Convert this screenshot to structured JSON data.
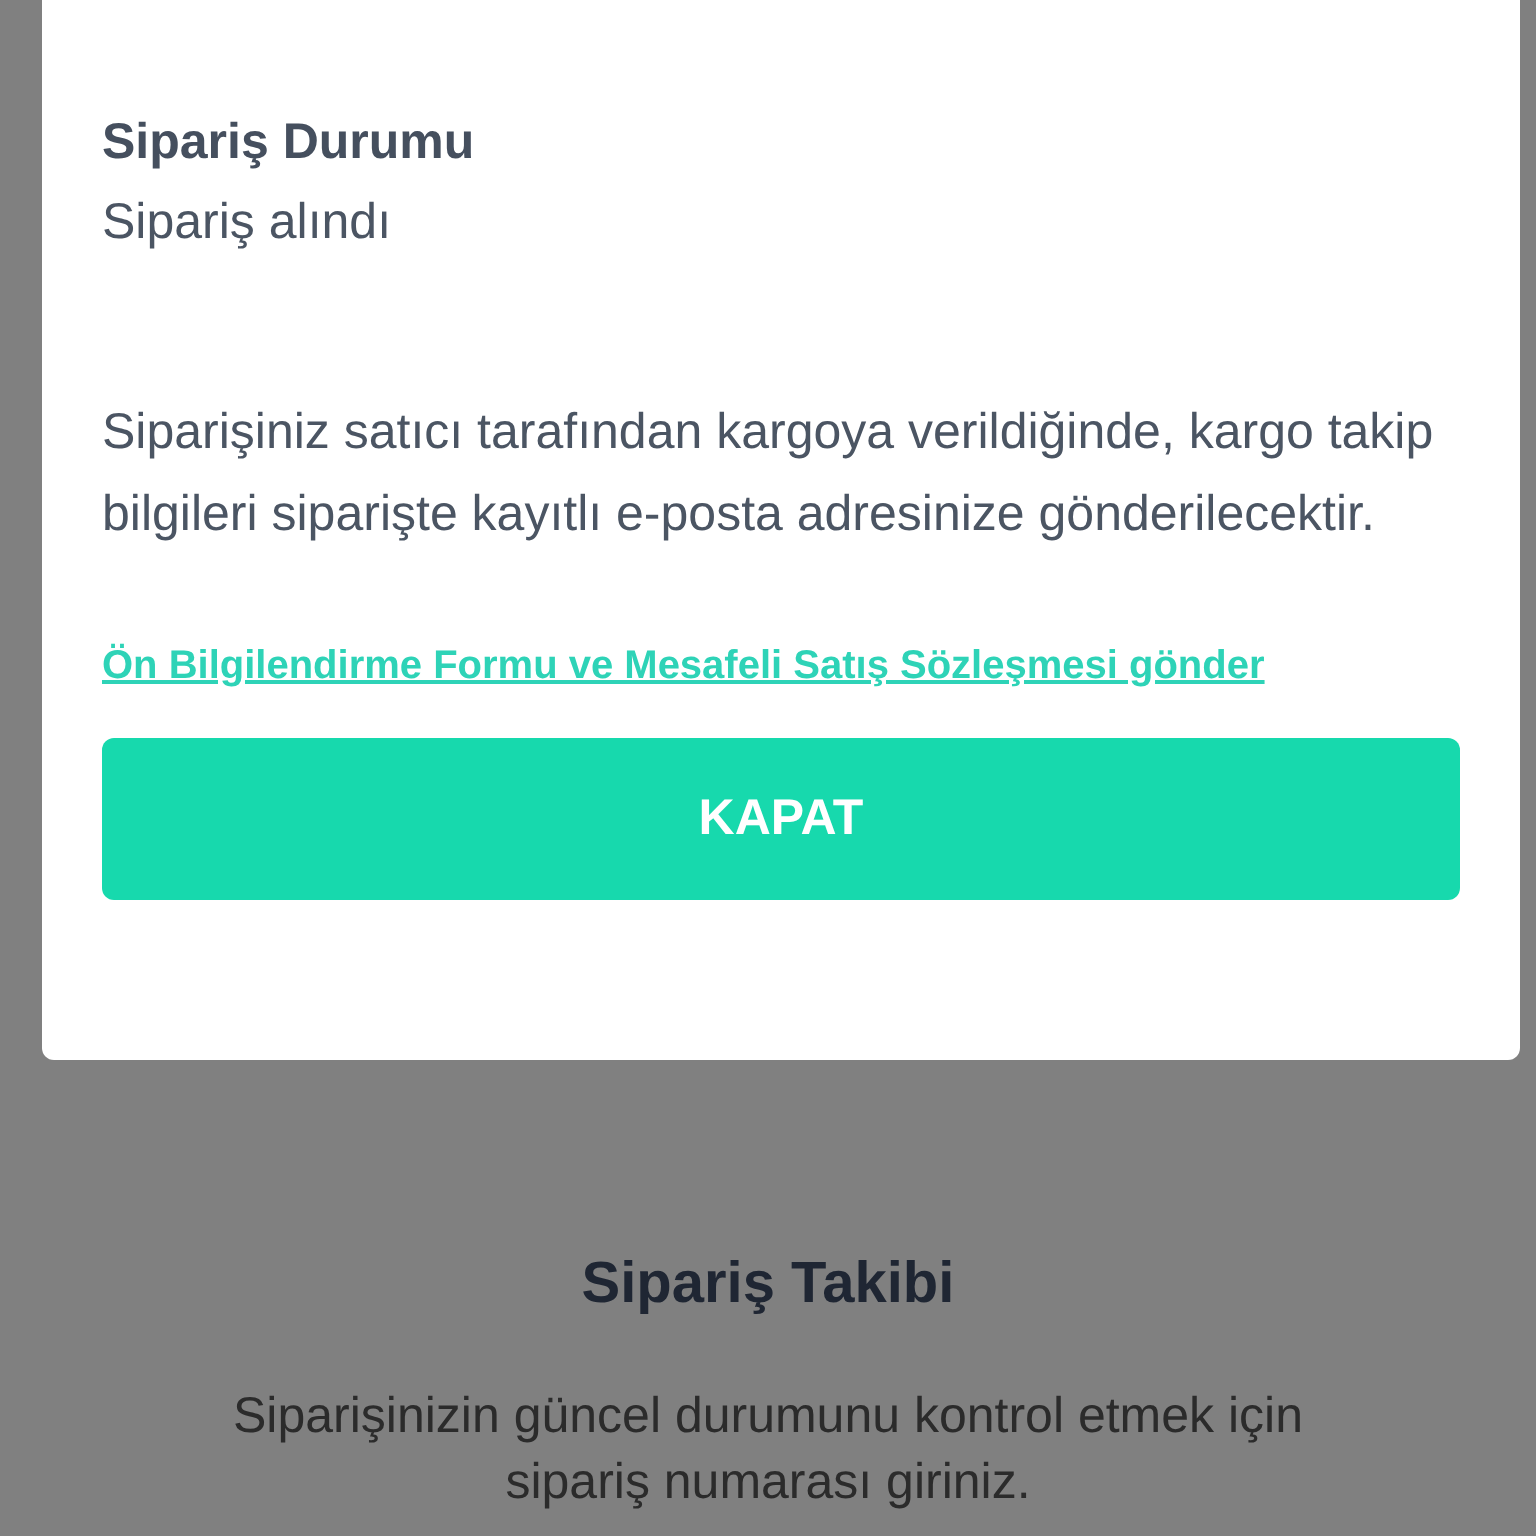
{
  "background": {
    "title": "Sipariş Takibi",
    "description": "Siparişinizin güncel durumunu kontrol etmek için sipariş numarası giriniz."
  },
  "modal": {
    "status_label": "Sipariş Durumu",
    "status_value": "Sipariş alındı",
    "info": "Siparişiniz satıcı tarafından kargoya verildiğinde, kargo takip bilgileri siparişte kayıtlı e-posta adresinize gönderilecektir.",
    "link": "Ön Bilgilendirme Formu ve Mesafeli Satış Sözleşmesi gönder",
    "button": "KAPAT"
  }
}
